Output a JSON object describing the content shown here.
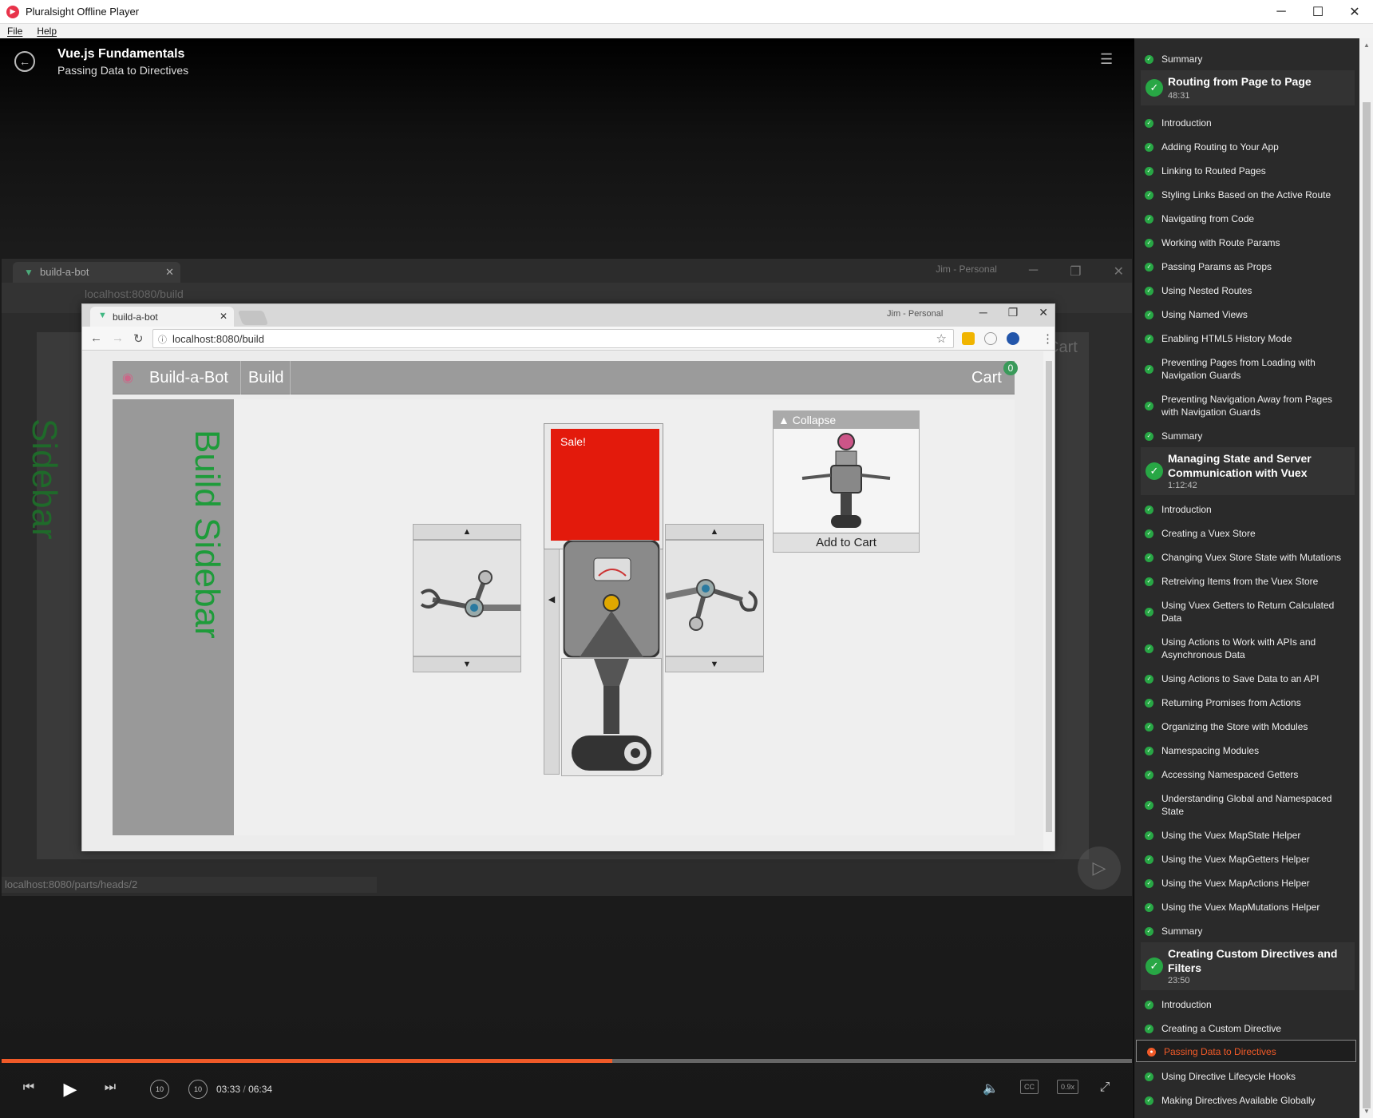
{
  "window": {
    "title": "Pluralsight Offline Player",
    "menu": [
      "File",
      "Help"
    ]
  },
  "player": {
    "course_title": "Vue.js Fundamentals",
    "clip_title": "Passing Data to Directives",
    "current_time": "03:33",
    "time_separator": "/",
    "total_time": "06:34",
    "progress_fraction": 0.54,
    "speed": "0.9x",
    "cc_label": "CC",
    "skip_back_label": "10",
    "skip_fwd_label": "10",
    "accent_color": "#f05a28"
  },
  "video": {
    "bg_tab_title": "build-a-bot",
    "bg_url": "localhost:8080/build",
    "bg_profile": "Jim - Personal",
    "bg_cart": "Cart",
    "bg_sidebar": "Sidebar",
    "status_url": "localhost:8080/parts/heads/2",
    "inner_tab_title": "build-a-bot",
    "inner_profile": "Jim - Personal",
    "inner_url": "localhost:8080/build",
    "app": {
      "brand": "Build-a-Bot",
      "nav_build": "Build",
      "cart_label": "Cart",
      "cart_count": "0",
      "sidebar_text": "Build Sidebar",
      "sale_label": "Sale!",
      "collapse_label": "▲ Collapse",
      "add_to_cart_label": "Add to Cart"
    }
  },
  "toc": {
    "items": [
      {
        "type": "clip",
        "title": "Summary",
        "status": "done"
      },
      {
        "type": "module",
        "title": "Routing from Page to Page",
        "duration": "48:31"
      },
      {
        "type": "clip",
        "title": "Introduction",
        "status": "done"
      },
      {
        "type": "clip",
        "title": "Adding Routing to Your App",
        "status": "done"
      },
      {
        "type": "clip",
        "title": "Linking to Routed Pages",
        "status": "done"
      },
      {
        "type": "clip",
        "title": "Styling Links Based on the Active Route",
        "status": "done"
      },
      {
        "type": "clip",
        "title": "Navigating from Code",
        "status": "done"
      },
      {
        "type": "clip",
        "title": "Working with Route Params",
        "status": "done"
      },
      {
        "type": "clip",
        "title": "Passing Params as Props",
        "status": "done"
      },
      {
        "type": "clip",
        "title": "Using Nested Routes",
        "status": "done"
      },
      {
        "type": "clip",
        "title": "Using Named Views",
        "status": "done"
      },
      {
        "type": "clip",
        "title": "Enabling HTML5 History Mode",
        "status": "done"
      },
      {
        "type": "clip",
        "title": "Preventing Pages from Loading with Navigation Guards",
        "status": "done"
      },
      {
        "type": "clip",
        "title": "Preventing Navigation Away from Pages with Navigation Guards",
        "status": "done"
      },
      {
        "type": "clip",
        "title": "Summary",
        "status": "done"
      },
      {
        "type": "module",
        "title": "Managing State and Server Communication with Vuex",
        "duration": "1:12:42"
      },
      {
        "type": "clip",
        "title": "Introduction",
        "status": "done"
      },
      {
        "type": "clip",
        "title": "Creating a Vuex Store",
        "status": "done"
      },
      {
        "type": "clip",
        "title": "Changing Vuex Store State with Mutations",
        "status": "done"
      },
      {
        "type": "clip",
        "title": "Retreiving Items from the Vuex Store",
        "status": "done"
      },
      {
        "type": "clip",
        "title": "Using Vuex Getters to Return Calculated Data",
        "status": "done"
      },
      {
        "type": "clip",
        "title": "Using Actions to Work with APIs and Asynchronous Data",
        "status": "done"
      },
      {
        "type": "clip",
        "title": "Using Actions to Save Data to an API",
        "status": "done"
      },
      {
        "type": "clip",
        "title": "Returning Promises from Actions",
        "status": "done"
      },
      {
        "type": "clip",
        "title": "Organizing the Store with Modules",
        "status": "done"
      },
      {
        "type": "clip",
        "title": "Namespacing Modules",
        "status": "done"
      },
      {
        "type": "clip",
        "title": "Accessing Namespaced Getters",
        "status": "done"
      },
      {
        "type": "clip",
        "title": "Understanding Global and Namespaced State",
        "status": "done"
      },
      {
        "type": "clip",
        "title": "Using the Vuex MapState Helper",
        "status": "done"
      },
      {
        "type": "clip",
        "title": "Using the Vuex MapGetters Helper",
        "status": "done"
      },
      {
        "type": "clip",
        "title": "Using the Vuex MapActions Helper",
        "status": "done"
      },
      {
        "type": "clip",
        "title": "Using the Vuex MapMutations Helper",
        "status": "done"
      },
      {
        "type": "clip",
        "title": "Summary",
        "status": "done"
      },
      {
        "type": "module",
        "title": "Creating Custom Directives and Filters",
        "duration": "23:50"
      },
      {
        "type": "clip",
        "title": "Introduction",
        "status": "done"
      },
      {
        "type": "clip",
        "title": "Creating a Custom Directive",
        "status": "done"
      },
      {
        "type": "clip",
        "title": "Passing Data to Directives",
        "status": "current"
      },
      {
        "type": "clip",
        "title": "Using Directive Lifecycle Hooks",
        "status": "done"
      },
      {
        "type": "clip",
        "title": "Making Directives Available Globally",
        "status": "done"
      }
    ]
  }
}
